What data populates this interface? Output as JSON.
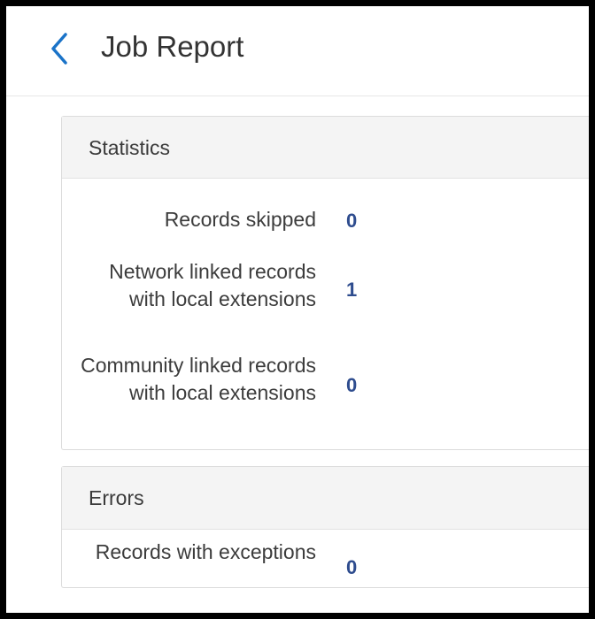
{
  "header": {
    "title": "Job Report",
    "back_icon": "chevron-left-icon",
    "accent_color": "#1a73c8"
  },
  "statistics": {
    "title": "Statistics",
    "rows": [
      {
        "label": "Records skipped",
        "value": "0"
      },
      {
        "label": "Network linked records with local extensions",
        "value": "1"
      },
      {
        "label": "Community linked records with local extensions",
        "value": "0"
      }
    ]
  },
  "errors": {
    "title": "Errors",
    "rows": [
      {
        "label": "Records with exceptions",
        "value": "0"
      }
    ]
  },
  "colors": {
    "value_text": "#2e4c8e",
    "panel_header_bg": "#f4f4f4"
  }
}
